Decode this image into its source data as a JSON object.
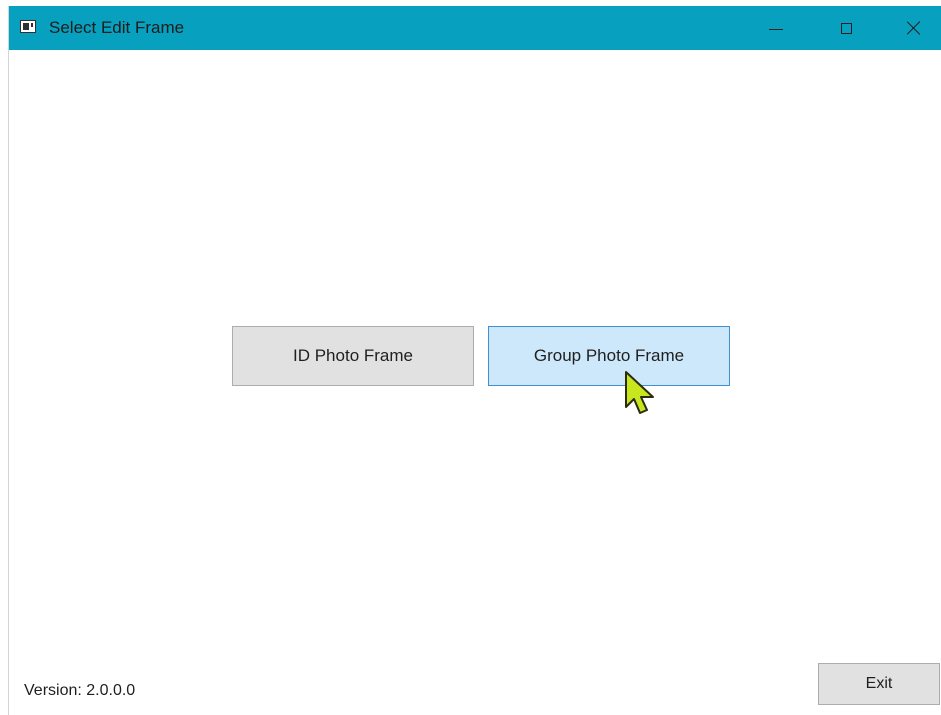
{
  "window": {
    "title": "Select Edit Frame",
    "accent_color": "#07a0bf"
  },
  "titlebar": {
    "app_icon": "app-window-icon",
    "minimize_icon": "minimize-icon",
    "maximize_icon": "maximize-icon",
    "close_icon": "close-icon"
  },
  "main": {
    "buttons": [
      {
        "label": "ID Photo Frame"
      },
      {
        "label": "Group Photo Frame",
        "state": "hover"
      }
    ]
  },
  "footer": {
    "version": "Version: 2.0.0.0",
    "exit_label": "Exit"
  },
  "cursor": {
    "icon": "mouse-pointer-icon",
    "color": "#c8e61e"
  }
}
